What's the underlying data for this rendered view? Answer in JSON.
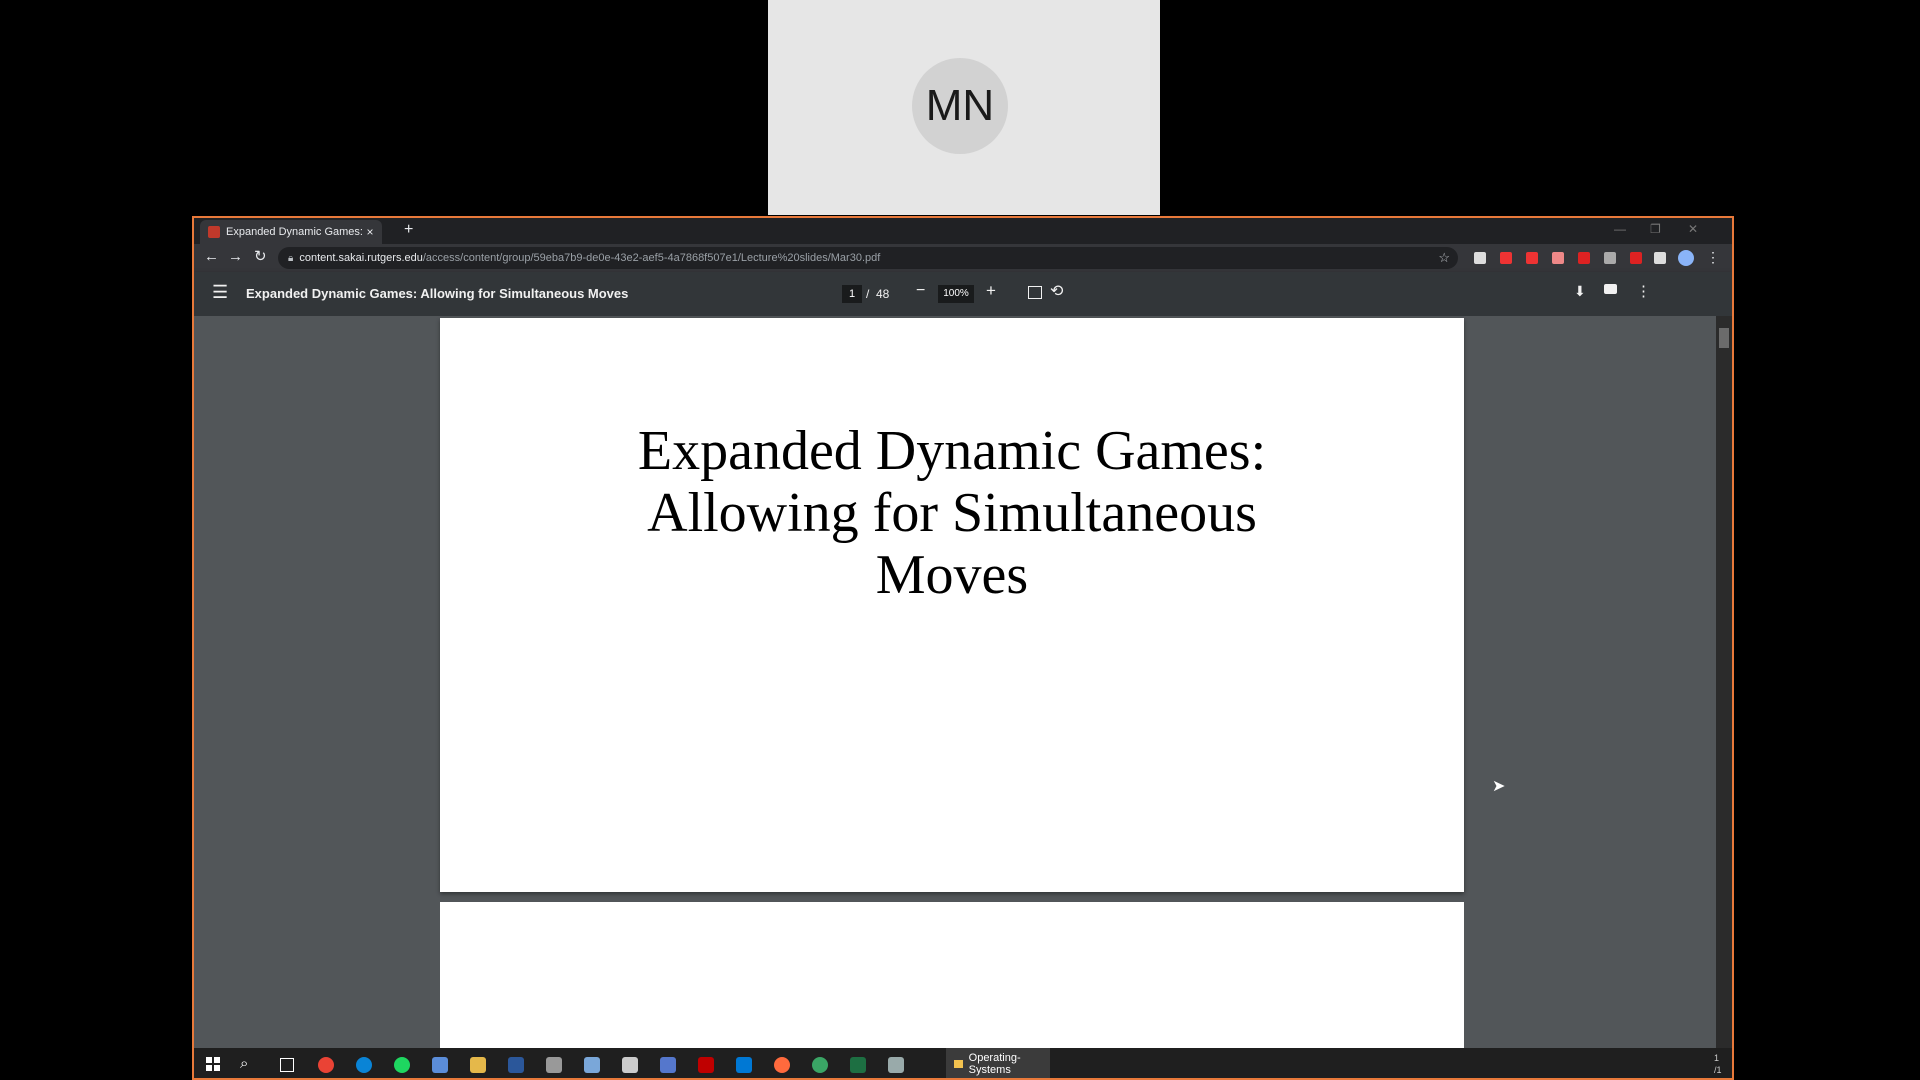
{
  "participant": {
    "initials": "MN"
  },
  "browser": {
    "tab_title": "Expanded Dynamic Games: Allo",
    "tab_close": "×",
    "new_tab": "+",
    "window_controls": {
      "minimize": "—",
      "maximize": "❐",
      "close": "✕"
    },
    "nav": {
      "back": "←",
      "forward": "→",
      "reload": "↻"
    },
    "url_host": "content.sakai.rutgers.edu",
    "url_path": "/access/content/group/59eba7b9-de0e-43e2-aef5-4a7868f507e1/Lecture%20slides/Mar30.pdf",
    "colors": {
      "ext": [
        "#ddd",
        "#e33",
        "#e33",
        "#e88",
        "#d22",
        "#aaa",
        "#d22",
        "#ddd"
      ]
    }
  },
  "pdf": {
    "title": "Expanded Dynamic Games: Allowing for Simultaneous Moves",
    "page_current": "1",
    "page_sep": "/",
    "page_total": "48",
    "zoom": "100%",
    "menu_icon": "☰",
    "zoom_out": "−",
    "zoom_in": "+",
    "rotate": "⟲",
    "download": "⬇",
    "more": "⋮",
    "slide_title_lines": [
      "Expanded Dynamic Games:",
      "Allowing for Simultaneous",
      "Moves"
    ]
  },
  "taskbar": {
    "search": "⌕",
    "active_app": "Operating-Systems",
    "icon_colors": [
      "#ea4335",
      "#0a84d6",
      "#1ed760",
      "#5b8dd9",
      "#e5b84a",
      "#2b579a",
      "#999",
      "#7aa7d9",
      "#ccc",
      "#5577cc",
      "#bf0000",
      "#0078d4",
      "#ff6a3d",
      "#3aa565",
      "#1d6f42",
      "#9aa"
    ],
    "tray_time": "1",
    "tray_date": "/1"
  }
}
